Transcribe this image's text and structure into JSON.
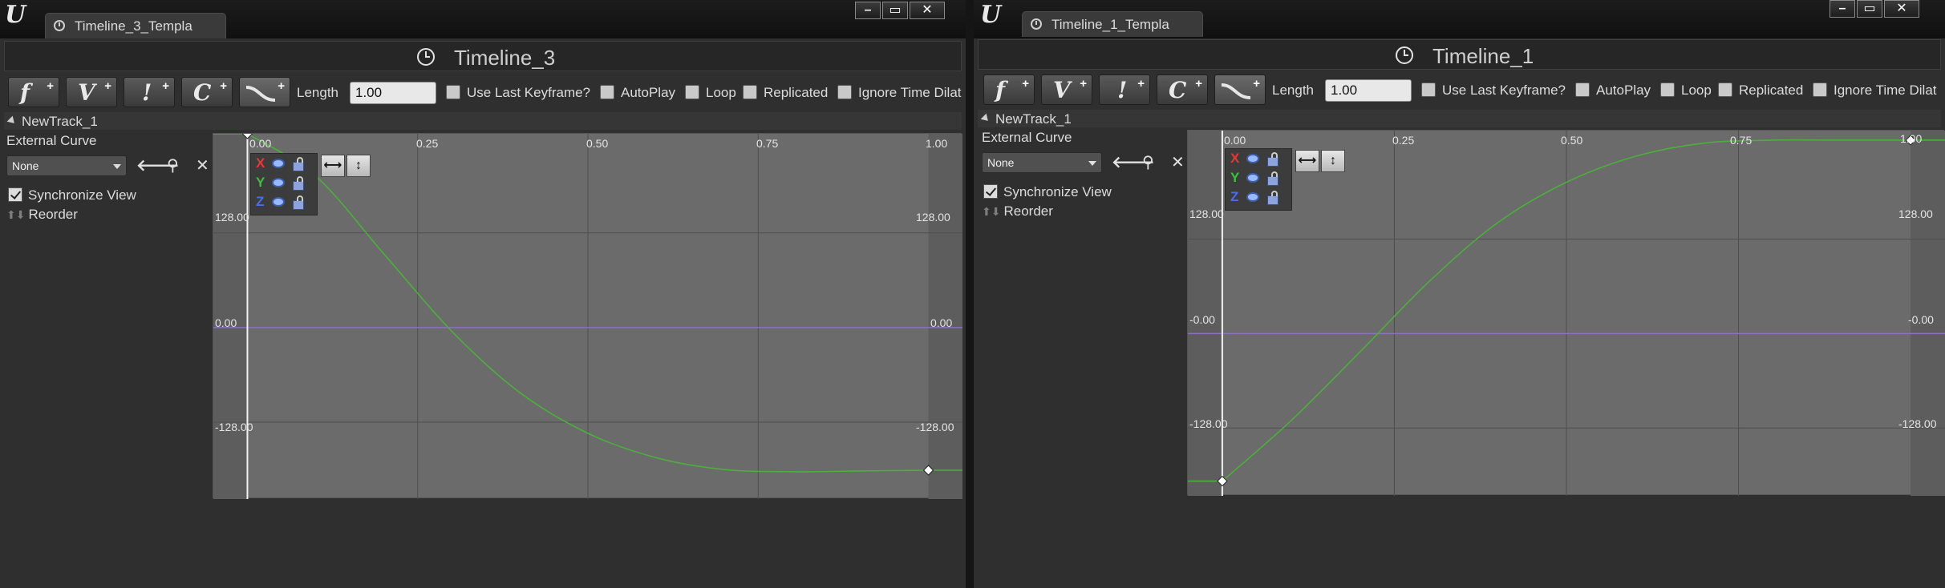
{
  "colors": {
    "curve": "#4caf3c",
    "zero_line": "#8d6fc0",
    "graph_bg": "#6b6b6b",
    "panel_bg": "#2f2f2f",
    "x_channel": "#e53935",
    "y_channel": "#39c23a",
    "z_channel": "#4b6ee8"
  },
  "toolbar_common": {
    "add_float_track_icon": "f",
    "add_vector_track_icon": "V",
    "add_event_track_icon": "!",
    "add_color_track_icon": "C",
    "add_curve_icon": "curve-icon",
    "plus": "+",
    "length_label": "Length",
    "use_last_keyframe_label": "Use Last Keyframe?",
    "autoplay_label": "AutoPlay",
    "loop_label": "Loop",
    "replicated_label": "Replicated",
    "ignore_time_dilation_label": "Ignore Time Dilat"
  },
  "panel_common": {
    "external_curve_label": "External Curve",
    "external_curve_value": "None",
    "synchronize_view_label": "Synchronize View",
    "reorder_label": "Reorder",
    "x_label": "X",
    "y_label": "Y",
    "z_label": "Z",
    "fit_horizontal": "⟷",
    "fit_vertical": "↕"
  },
  "windows": [
    {
      "tab_label": "Timeline_3_Templa",
      "title": "Timeline_3",
      "length_value": "1.00",
      "track_name": "NewTrack_1",
      "x_ticks": [
        "0.00",
        "0.25",
        "0.50",
        "0.75",
        "1.00"
      ],
      "y_ticks_left": [
        "128.00",
        "0.00",
        "-128.00"
      ],
      "y_ticks_right": [
        "128.00",
        "0.00",
        "-128.00"
      ],
      "chart_data": {
        "type": "line",
        "x": [
          0.0,
          0.1,
          0.2,
          0.3,
          0.4,
          0.5,
          0.6,
          0.7,
          0.8,
          0.9,
          1.0
        ],
        "values": [
          262,
          205,
          100,
          -5,
          -88,
          -143,
          -176,
          -192,
          -195,
          -194,
          -193
        ],
        "xlim": [
          -0.05,
          1.05
        ],
        "ylim": [
          -232,
          262
        ],
        "keys": [
          {
            "x": 0.0,
            "y": 262
          },
          {
            "x": 1.0,
            "y": -193
          }
        ]
      }
    },
    {
      "tab_label": "Timeline_1_Templa",
      "title": "Timeline_1",
      "length_value": "1.00",
      "track_name": "NewTrack_1",
      "x_ticks": [
        "0.00",
        "0.25",
        "0.50",
        "0.75",
        "1.00"
      ],
      "y_ticks_left": [
        "128.00",
        "-0.00",
        "-128.00"
      ],
      "y_ticks_right": [
        "128.00",
        "-0.00",
        "-128.00"
      ],
      "chart_data": {
        "type": "line",
        "x": [
          0.0,
          0.1,
          0.2,
          0.3,
          0.4,
          0.5,
          0.6,
          0.7,
          0.8,
          0.9,
          1.0
        ],
        "values": [
          -200,
          -118,
          -25,
          70,
          150,
          205,
          240,
          258,
          262,
          262,
          262
        ],
        "xlim": [
          -0.05,
          1.05
        ],
        "ylim": [
          -220,
          275
        ],
        "keys": [
          {
            "x": 0.0,
            "y": -200
          },
          {
            "x": 1.0,
            "y": 262
          }
        ]
      }
    }
  ]
}
